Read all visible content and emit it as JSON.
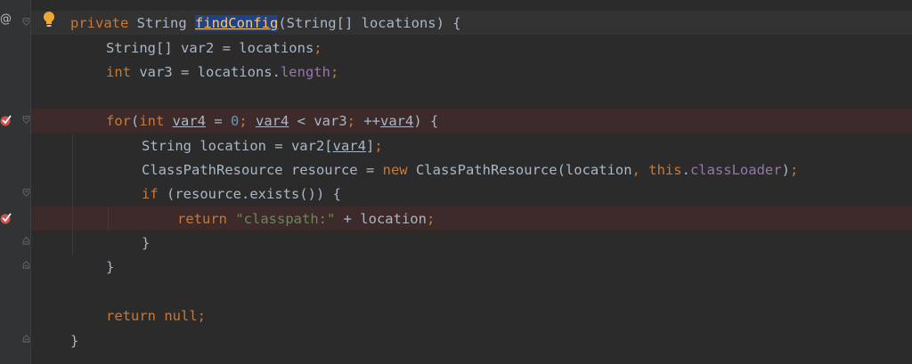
{
  "editor": {
    "lines": [
      {
        "id": "L1",
        "tokens": [
          {
            "t": "private ",
            "c": "kw"
          },
          {
            "t": "String ",
            "c": ""
          },
          {
            "t": "findConfig",
            "c": "sel"
          },
          {
            "t": "(String[] locations) {",
            "c": ""
          }
        ]
      },
      {
        "id": "L2",
        "tokens": [
          {
            "t": "String[] var2 = locations",
            "c": ""
          },
          {
            "t": ";",
            "c": "kw"
          }
        ]
      },
      {
        "id": "L3",
        "tokens": [
          {
            "t": "int ",
            "c": "kw"
          },
          {
            "t": "var3 = locations.",
            "c": ""
          },
          {
            "t": "length",
            "c": "field"
          },
          {
            "t": ";",
            "c": "kw"
          }
        ]
      },
      {
        "id": "L4",
        "tokens": []
      },
      {
        "id": "L5",
        "tokens": [
          {
            "t": "for",
            "c": "kw"
          },
          {
            "t": "(",
            "c": ""
          },
          {
            "t": "int ",
            "c": "kw"
          },
          {
            "t": "var4",
            "c": "ul"
          },
          {
            "t": " = ",
            "c": ""
          },
          {
            "t": "0",
            "c": "num"
          },
          {
            "t": "; ",
            "c": "kw"
          },
          {
            "t": "var4",
            "c": "ul"
          },
          {
            "t": " < var3",
            "c": ""
          },
          {
            "t": "; ",
            "c": "kw"
          },
          {
            "t": "++",
            "c": ""
          },
          {
            "t": "var4",
            "c": "ul"
          },
          {
            "t": ") {",
            "c": ""
          }
        ]
      },
      {
        "id": "L6",
        "tokens": [
          {
            "t": "String location = var2[",
            "c": ""
          },
          {
            "t": "var4",
            "c": "ul"
          },
          {
            "t": "]",
            "c": ""
          },
          {
            "t": ";",
            "c": "kw"
          }
        ]
      },
      {
        "id": "L7",
        "tokens": [
          {
            "t": "ClassPathResource resource = ",
            "c": ""
          },
          {
            "t": "new ",
            "c": "kw"
          },
          {
            "t": "ClassPathResource(location",
            "c": ""
          },
          {
            "t": ", ",
            "c": "kw"
          },
          {
            "t": "this",
            "c": "kw"
          },
          {
            "t": ".",
            "c": ""
          },
          {
            "t": "classLoader",
            "c": "field"
          },
          {
            "t": ")",
            "c": ""
          },
          {
            "t": ";",
            "c": "kw"
          }
        ]
      },
      {
        "id": "L8",
        "tokens": [
          {
            "t": "if ",
            "c": "kw"
          },
          {
            "t": "(resource.exists()) {",
            "c": ""
          }
        ]
      },
      {
        "id": "L9",
        "tokens": [
          {
            "t": "return ",
            "c": "kw"
          },
          {
            "t": "\"classpath:\"",
            "c": "str"
          },
          {
            "t": " + location",
            "c": ""
          },
          {
            "t": ";",
            "c": "kw"
          }
        ]
      },
      {
        "id": "L10",
        "tokens": [
          {
            "t": "}",
            "c": ""
          }
        ]
      },
      {
        "id": "L11",
        "tokens": [
          {
            "t": "}",
            "c": ""
          }
        ]
      },
      {
        "id": "L12",
        "tokens": []
      },
      {
        "id": "L13",
        "tokens": [
          {
            "t": "return null",
            "c": "kw"
          },
          {
            "t": ";",
            "c": "kw"
          }
        ]
      },
      {
        "id": "L14",
        "tokens": [
          {
            "t": "}",
            "c": ""
          }
        ]
      }
    ]
  },
  "gutter": {
    "at_marker": "@"
  },
  "colors": {
    "background": "#2b2b2b",
    "keyword": "#cc7832",
    "number": "#6897bb",
    "string": "#6a8759",
    "field": "#9876aa",
    "breakpoint_line": "#3d2a2a",
    "selection": "#214283"
  }
}
